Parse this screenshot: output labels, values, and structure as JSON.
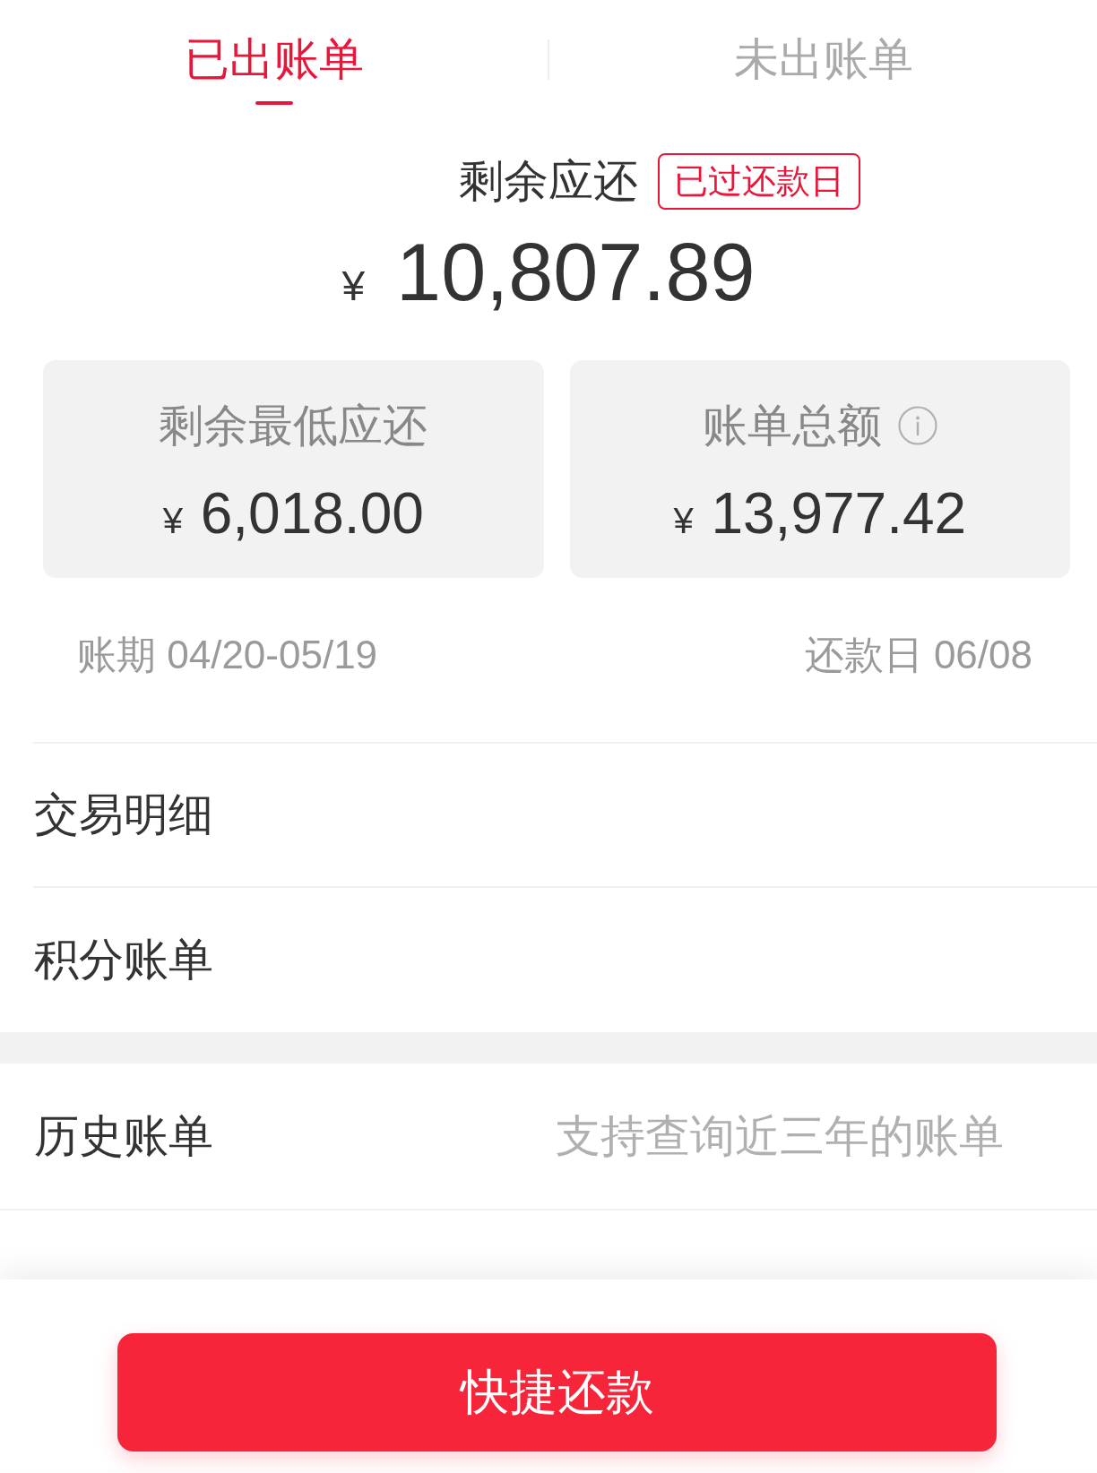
{
  "tabs": [
    {
      "label": "已出账单",
      "selected": true
    },
    {
      "label": "未出账单",
      "selected": false
    }
  ],
  "summary": {
    "label": "剩余应还",
    "badge": "已过还款日",
    "currency": "¥",
    "amount": "10,807.89"
  },
  "cards": [
    {
      "label": "剩余最低应还",
      "info": false,
      "currency": "¥",
      "amount": "6,018.00"
    },
    {
      "label": "账单总额",
      "info": true,
      "currency": "¥",
      "amount": "13,977.42"
    }
  ],
  "period": {
    "billing_period": "账期 04/20-05/19",
    "due_date": "还款日 06/08"
  },
  "sections": [
    {
      "rows": [
        {
          "label": "交易明细"
        },
        {
          "label": "积分账单"
        }
      ]
    },
    {
      "rows": [
        {
          "label": "历史账单",
          "hint": "支持查询近三年的账单"
        }
      ]
    }
  ],
  "action_button": "快捷还款"
}
